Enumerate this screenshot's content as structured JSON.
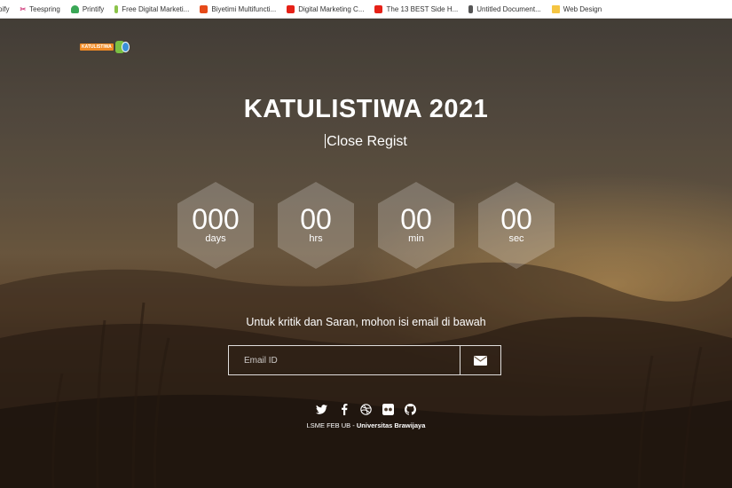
{
  "bookmarks": [
    {
      "label": "pify",
      "icon": "none"
    },
    {
      "label": "Teespring",
      "icon": "teespring-icon"
    },
    {
      "label": "Printify",
      "icon": "printify-icon"
    },
    {
      "label": "Free Digital Marketi...",
      "icon": "leaf-icon"
    },
    {
      "label": "Biyetimi Multifuncti...",
      "icon": "red-app-icon"
    },
    {
      "label": "Digital Marketing C...",
      "icon": "youtube-icon"
    },
    {
      "label": "The 13 BEST Side H...",
      "icon": "youtube-icon"
    },
    {
      "label": "Untitled Document...",
      "icon": "pen-icon"
    },
    {
      "label": "Web Design",
      "icon": "folder-icon"
    }
  ],
  "page": {
    "logo_text": "KATULISTIWA",
    "title": "KATULISTIWA 2021",
    "subtitle": "Close Regist",
    "countdown": [
      {
        "value": "000",
        "unit": "days"
      },
      {
        "value": "00",
        "unit": "hrs"
      },
      {
        "value": "00",
        "unit": "min"
      },
      {
        "value": "00",
        "unit": "sec"
      }
    ],
    "message": "Untuk kritik dan Saran, mohon isi email di bawah",
    "email_placeholder": "Email ID",
    "social_icons": [
      "twitter-icon",
      "facebook-icon",
      "dribbble-icon",
      "flickr-icon",
      "github-icon"
    ],
    "footer_left": "LSME FEB UB",
    "footer_sep": " - ",
    "footer_right": "Universitas Brawijaya"
  }
}
